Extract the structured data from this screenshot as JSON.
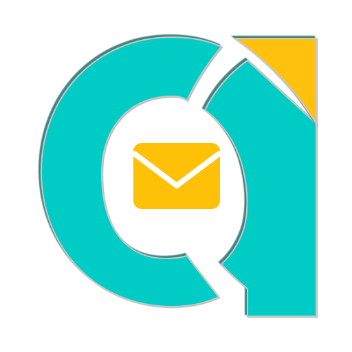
{
  "logo": {
    "name": "app-logo",
    "colors": {
      "primary": "#00CCC6",
      "accent": "#FFC107",
      "shadow": "#2E7C7A",
      "outline": "#C8C8C8",
      "background": "#FFFFFF"
    },
    "icon": "envelope-icon"
  }
}
